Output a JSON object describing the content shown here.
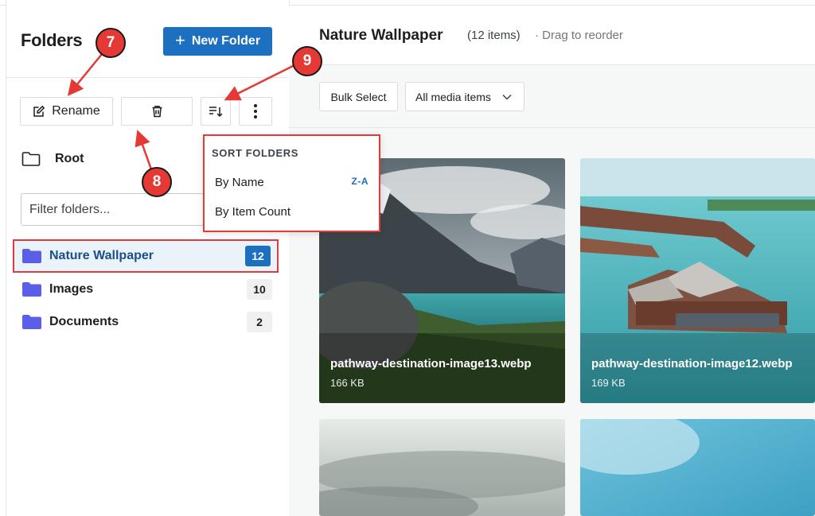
{
  "sidebar": {
    "title": "Folders",
    "new_folder_label": "New Folder",
    "rename_label": "Rename",
    "root_label": "Root",
    "filter_placeholder": "Filter folders...",
    "folders": [
      {
        "label": "Nature Wallpaper",
        "count": "12",
        "active": true
      },
      {
        "label": "Images",
        "count": "10"
      },
      {
        "label": "Documents",
        "count": "2"
      }
    ]
  },
  "sort_menu": {
    "heading": "SORT FOLDERS",
    "items": [
      {
        "label": "By Name",
        "badge": "Z-A"
      },
      {
        "label": "By Item Count",
        "badge": ""
      }
    ]
  },
  "main": {
    "title": "Nature Wallpaper",
    "count_text": "(12 items)",
    "drag_text": "· Drag to reorder",
    "bulk_select_label": "Bulk Select",
    "media_filter_value": "All media items",
    "items": [
      {
        "filename": "pathway-destination-image13.webp",
        "size": "166 KB"
      },
      {
        "filename": "pathway-destination-image12.webp",
        "size": "169 KB"
      }
    ]
  },
  "callouts": [
    "7",
    "8",
    "9"
  ],
  "colors": {
    "accent": "#1d6fbf",
    "highlight": "#e33a3a",
    "folder_icon": "#5b5fe8"
  }
}
